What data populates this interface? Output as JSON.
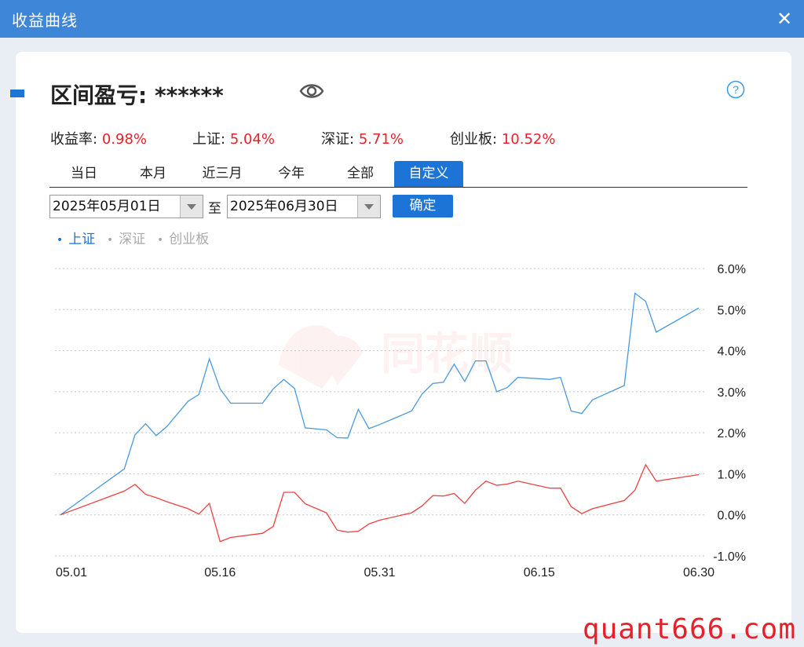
{
  "window": {
    "title": "收益曲线",
    "close_symbol": "✕"
  },
  "header": {
    "pnl_label": "区间盈亏:",
    "pnl_value": "******",
    "eye_icon": "eye-icon",
    "help_icon": "question-circle-icon"
  },
  "stats": [
    {
      "label": "收益率:",
      "value": "0.98%"
    },
    {
      "label": "上证:",
      "value": "5.04%"
    },
    {
      "label": "深证:",
      "value": "5.71%"
    },
    {
      "label": "创业板:",
      "value": "10.52%"
    }
  ],
  "tabs": [
    {
      "label": "当日",
      "active": false
    },
    {
      "label": "本月",
      "active": false
    },
    {
      "label": "近三月",
      "active": false
    },
    {
      "label": "今年",
      "active": false
    },
    {
      "label": "全部",
      "active": false
    },
    {
      "label": "自定义",
      "active": true
    }
  ],
  "date_range": {
    "start": "2025年05月01日",
    "separator": "至",
    "end": "2025年06月30日",
    "confirm_label": "确定"
  },
  "legend": [
    {
      "label": "上证",
      "active": true,
      "color": "#3a8ee6"
    },
    {
      "label": "深证",
      "active": false,
      "color": "#b0b0b0"
    },
    {
      "label": "创业板",
      "active": false,
      "color": "#b0b0b0"
    }
  ],
  "colors": {
    "accent": "#1b74d6",
    "positive": "#e8202a",
    "index_line": "#4a9ae0",
    "return_line": "#f04040"
  },
  "watermark": "quant666.com",
  "chart_data": {
    "type": "line",
    "x_ticks": [
      "05.01",
      "05.16",
      "05.31",
      "06.15",
      "06.30"
    ],
    "y_ticks": [
      "6.0%",
      "5.0%",
      "4.0%",
      "3.0%",
      "2.0%",
      "1.0%",
      "0.0%",
      "-1.0%"
    ],
    "ylim": [
      -1.0,
      6.0
    ],
    "grid": true,
    "series": [
      {
        "name": "上证",
        "color": "#4a9ae0",
        "x": [
          "05.01",
          "05.07",
          "05.08",
          "05.09",
          "05.10",
          "05.11",
          "05.13",
          "05.14",
          "05.15",
          "05.16",
          "05.17",
          "05.20",
          "05.21",
          "05.22",
          "05.23",
          "05.24",
          "05.26",
          "05.27",
          "05.28",
          "05.29",
          "05.30",
          "05.31",
          "06.03",
          "06.04",
          "06.05",
          "06.06",
          "06.07",
          "06.08",
          "06.09",
          "06.10",
          "06.11",
          "06.12",
          "06.13",
          "06.16",
          "06.17",
          "06.18",
          "06.19",
          "06.20",
          "06.23",
          "06.24",
          "06.25",
          "06.26",
          "06.30"
        ],
        "values": [
          0.0,
          1.12,
          1.95,
          2.22,
          1.93,
          2.15,
          2.77,
          2.93,
          3.8,
          3.07,
          2.72,
          2.72,
          3.07,
          3.3,
          3.08,
          2.12,
          2.07,
          1.88,
          1.87,
          2.57,
          2.1,
          2.2,
          2.53,
          2.95,
          3.2,
          3.23,
          3.67,
          3.25,
          3.75,
          3.75,
          3.0,
          3.1,
          3.35,
          3.3,
          3.35,
          2.53,
          2.47,
          2.8,
          3.15,
          5.4,
          5.2,
          4.45,
          5.04
        ]
      },
      {
        "name": "收益率",
        "color": "#f04040",
        "x": [
          "05.01",
          "05.07",
          "05.08",
          "05.09",
          "05.10",
          "05.11",
          "05.13",
          "05.14",
          "05.15",
          "05.16",
          "05.17",
          "05.20",
          "05.21",
          "05.22",
          "05.23",
          "05.24",
          "05.26",
          "05.27",
          "05.28",
          "05.29",
          "05.30",
          "05.31",
          "06.03",
          "06.04",
          "06.05",
          "06.06",
          "06.07",
          "06.08",
          "06.09",
          "06.10",
          "06.11",
          "06.12",
          "06.13",
          "06.16",
          "06.17",
          "06.18",
          "06.19",
          "06.20",
          "06.23",
          "06.24",
          "06.25",
          "06.26",
          "06.30"
        ],
        "values": [
          0.0,
          0.58,
          0.74,
          0.5,
          0.42,
          0.32,
          0.15,
          0.02,
          0.28,
          -0.65,
          -0.55,
          -0.45,
          -0.28,
          0.55,
          0.55,
          0.27,
          0.05,
          -0.37,
          -0.42,
          -0.4,
          -0.22,
          -0.13,
          0.05,
          0.22,
          0.47,
          0.46,
          0.52,
          0.28,
          0.6,
          0.82,
          0.72,
          0.75,
          0.82,
          0.65,
          0.65,
          0.2,
          0.03,
          0.15,
          0.35,
          0.6,
          1.22,
          0.82,
          0.98
        ]
      }
    ]
  }
}
